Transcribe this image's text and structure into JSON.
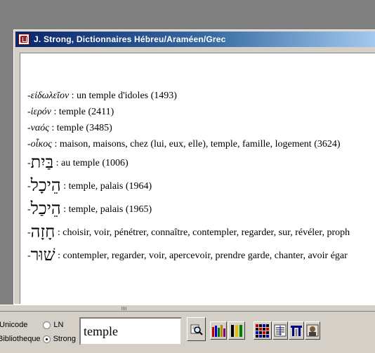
{
  "window": {
    "title": "J. Strong, Dictionnaires Hébreu/Araméen/Grec"
  },
  "entries": [
    {
      "prefix": "-",
      "term": "εἰδωλεῖον",
      "script": "greek",
      "definition": " : un temple d'idoles (1493)"
    },
    {
      "prefix": "-",
      "term": "ἱερόν",
      "script": "greek",
      "definition": " : temple (2411)"
    },
    {
      "prefix": "-",
      "term": "ναός",
      "script": "greek",
      "definition": " : temple (3485)"
    },
    {
      "prefix": "-",
      "term": "οἶκος",
      "script": "greek",
      "definition": " : maison, maisons, chez (lui, eux, elle), temple, famille, logement (3624)"
    },
    {
      "prefix": "-",
      "term": "בַּיִת",
      "script": "hebrew",
      "definition": " : au temple (1006)"
    },
    {
      "prefix": "-",
      "term": "הֵיכָל",
      "script": "hebrew",
      "definition": " : temple, palais (1964)"
    },
    {
      "prefix": "-",
      "term": "הֵיכַל",
      "script": "hebrew",
      "definition": " : temple, palais (1965)"
    },
    {
      "prefix": "-",
      "term": "חָזָה",
      "script": "hebrew",
      "definition": " : choisir, voir, pénétrer, connaître, contempler, regarder, sur, révéler, proph"
    },
    {
      "prefix": "-",
      "term": "שׁוּר",
      "script": "hebrew",
      "definition": " : contempler, regarder, voir, apercevoir, prendre garde, chanter, avoir égar"
    }
  ],
  "toolbar": {
    "encoding_label": "Unicode",
    "encoding_option": "LN",
    "library_label": "Bibliotheque",
    "library_option": "Strong",
    "search_value": "temple",
    "icons": [
      "search-icon",
      "bookshelf-icon",
      "grid-icon",
      "text-lines-icon",
      "columns-icon",
      "portrait-icon"
    ]
  }
}
